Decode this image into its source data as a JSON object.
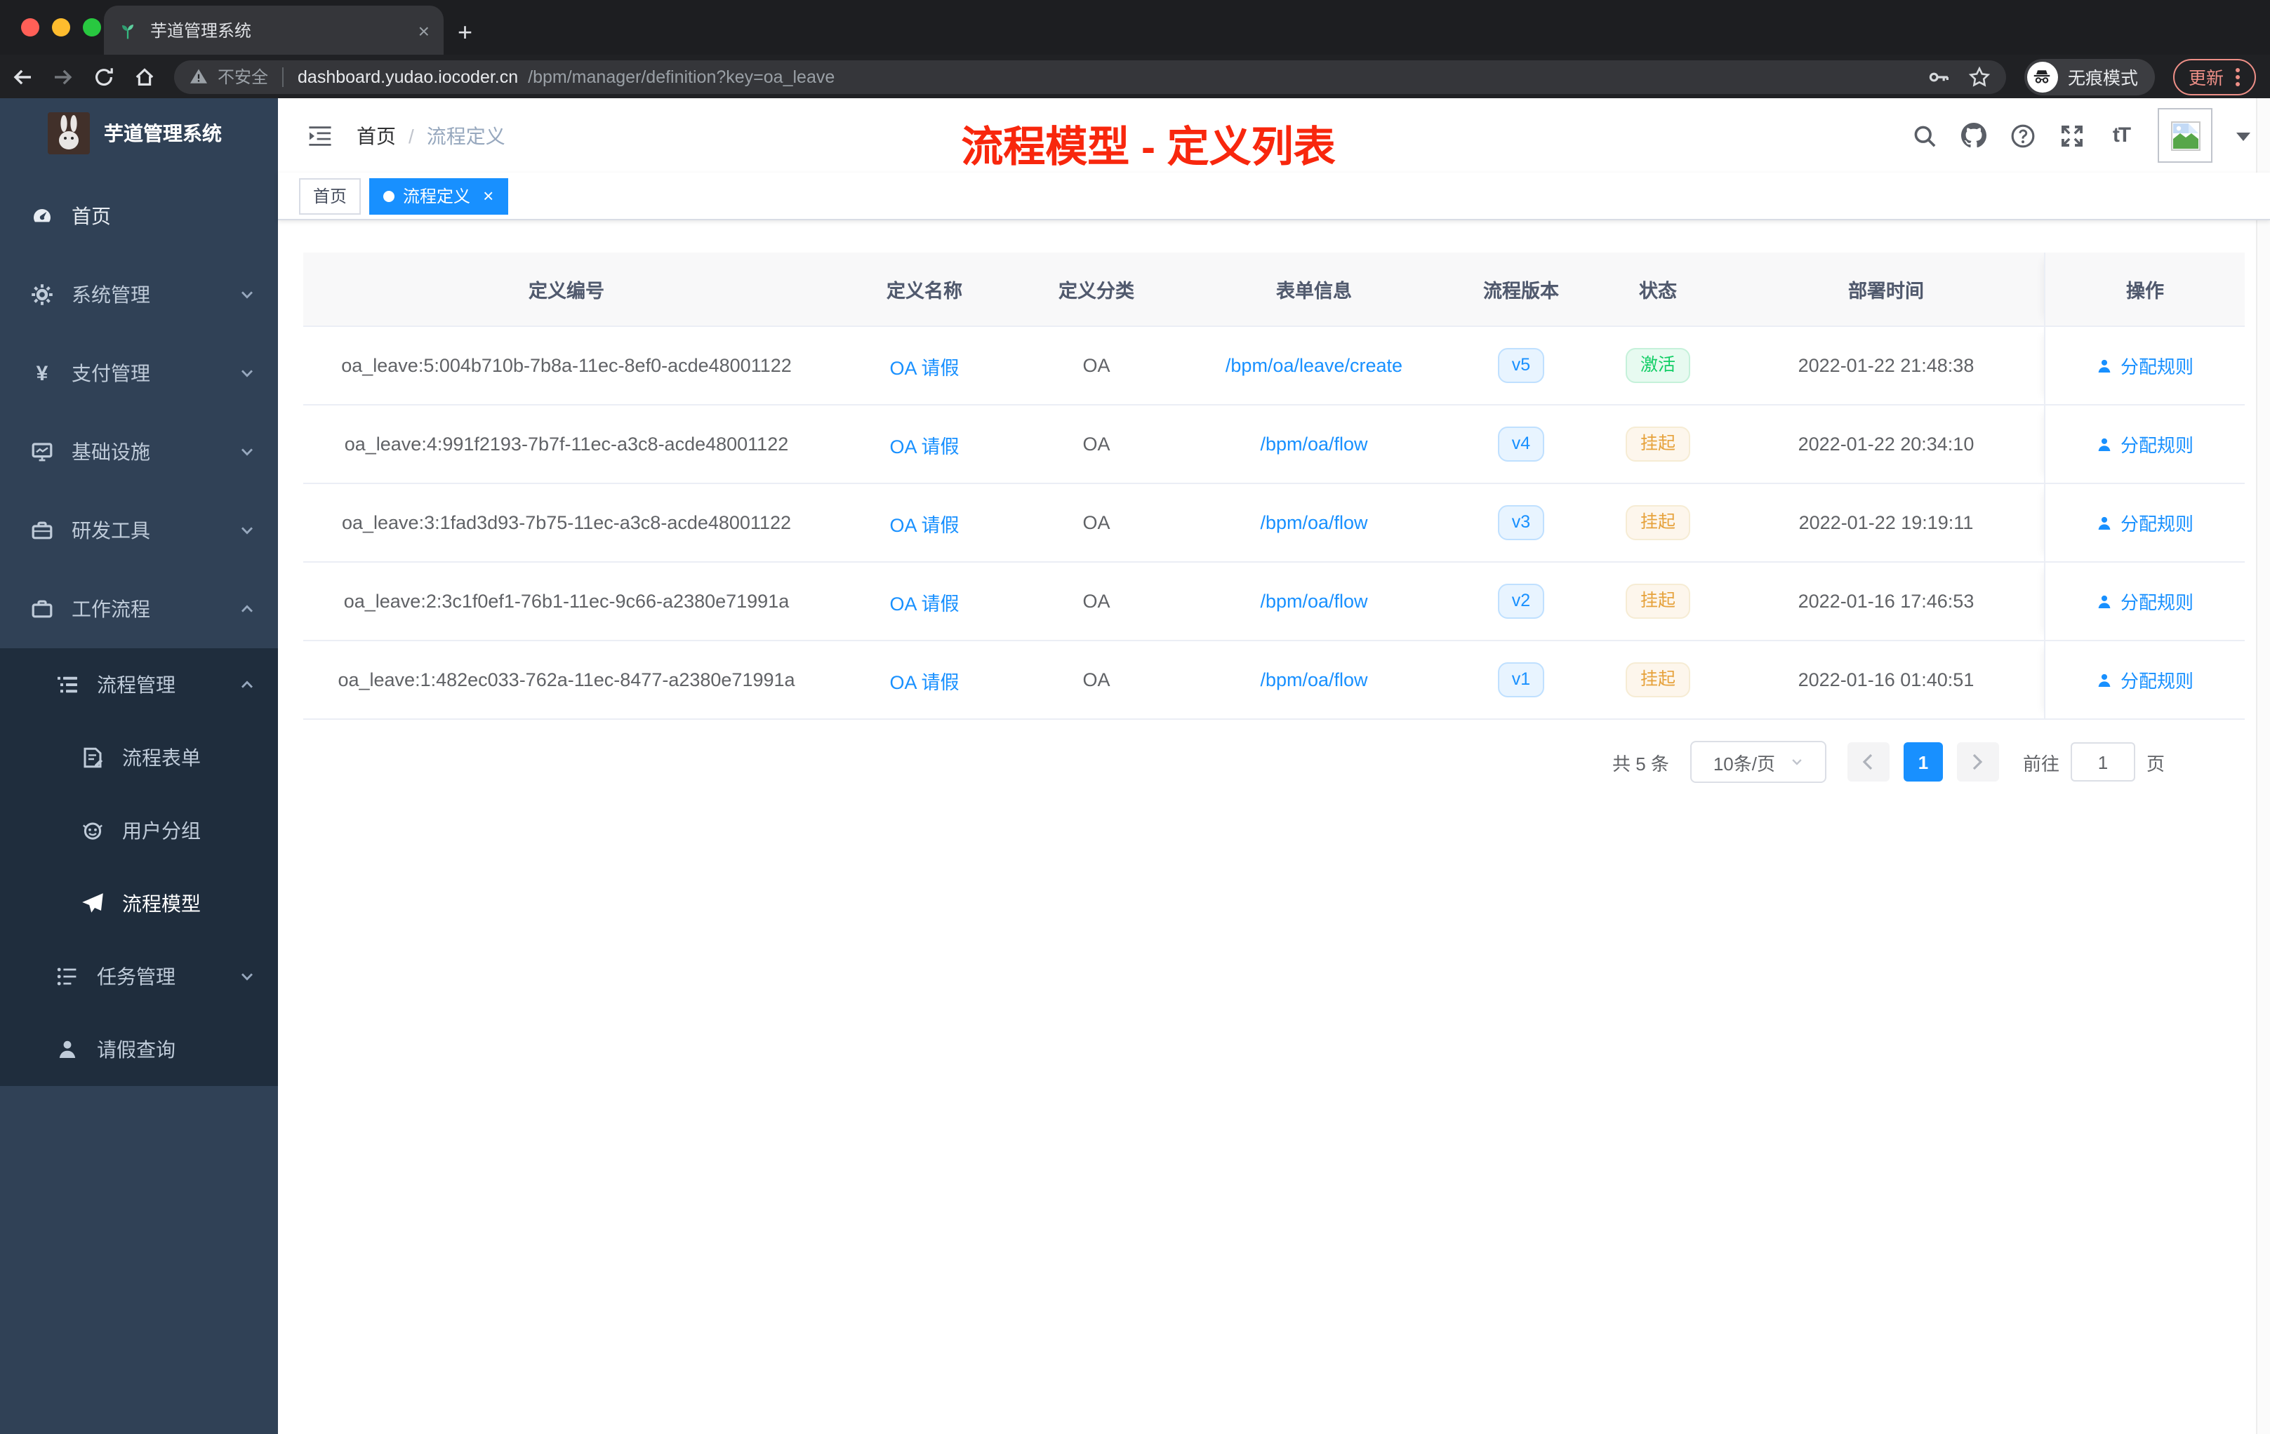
{
  "browser": {
    "tab_title": "芋道管理系统",
    "security_label": "不安全",
    "url_host": "dashboard.yudao.iocoder.cn",
    "url_path": "/bpm/manager/definition?key=oa_leave",
    "incognito_label": "无痕模式",
    "update_label": "更新"
  },
  "sidebar": {
    "app_title": "芋道管理系统",
    "items": [
      {
        "label": "首页",
        "icon": "dashboard-icon",
        "level": 0
      },
      {
        "label": "系统管理",
        "icon": "gear-icon",
        "level": 0,
        "chevron": "down"
      },
      {
        "label": "支付管理",
        "icon": "yen-icon",
        "level": 0,
        "chevron": "down"
      },
      {
        "label": "基础设施",
        "icon": "monitor-icon",
        "level": 0,
        "chevron": "down"
      },
      {
        "label": "研发工具",
        "icon": "toolbox-icon",
        "level": 0,
        "chevron": "down"
      },
      {
        "label": "工作流程",
        "icon": "briefcase-icon",
        "level": 0,
        "chevron": "up"
      },
      {
        "label": "流程管理",
        "icon": "tree-list-icon",
        "level": 1,
        "chevron": "up"
      },
      {
        "label": "流程表单",
        "icon": "form-icon",
        "level": 2
      },
      {
        "label": "用户分组",
        "icon": "robot-icon",
        "level": 2
      },
      {
        "label": "流程模型",
        "icon": "paper-plane-icon",
        "level": 2,
        "active": true
      },
      {
        "label": "任务管理",
        "icon": "flow-icon",
        "level": 1,
        "chevron": "down"
      },
      {
        "label": "请假查询",
        "icon": "person-icon",
        "level": 1
      }
    ]
  },
  "header": {
    "breadcrumb_home": "首页",
    "breadcrumb_separator": "/",
    "breadcrumb_current": "流程定义",
    "annotation": "流程模型 - 定义列表"
  },
  "tags": [
    {
      "label": "首页",
      "active": false
    },
    {
      "label": "流程定义",
      "active": true,
      "closable": true
    }
  ],
  "table": {
    "columns": [
      "定义编号",
      "定义名称",
      "定义分类",
      "表单信息",
      "流程版本",
      "状态",
      "部署时间",
      "操作"
    ],
    "rows": [
      {
        "id": "oa_leave:5:004b710b-7b8a-11ec-8ef0-acde48001122",
        "name": "OA 请假",
        "category": "OA",
        "form": "/bpm/oa/leave/create",
        "version": "v5",
        "status": "激活",
        "status_type": "active",
        "time": "2022-01-22 21:48:38",
        "action": "分配规则"
      },
      {
        "id": "oa_leave:4:991f2193-7b7f-11ec-a3c8-acde48001122",
        "name": "OA 请假",
        "category": "OA",
        "form": "/bpm/oa/flow",
        "version": "v4",
        "status": "挂起",
        "status_type": "suspended",
        "time": "2022-01-22 20:34:10",
        "action": "分配规则"
      },
      {
        "id": "oa_leave:3:1fad3d93-7b75-11ec-a3c8-acde48001122",
        "name": "OA 请假",
        "category": "OA",
        "form": "/bpm/oa/flow",
        "version": "v3",
        "status": "挂起",
        "status_type": "suspended",
        "time": "2022-01-22 19:19:11",
        "action": "分配规则"
      },
      {
        "id": "oa_leave:2:3c1f0ef1-76b1-11ec-9c66-a2380e71991a",
        "name": "OA 请假",
        "category": "OA",
        "form": "/bpm/oa/flow",
        "version": "v2",
        "status": "挂起",
        "status_type": "suspended",
        "time": "2022-01-16 17:46:53",
        "action": "分配规则"
      },
      {
        "id": "oa_leave:1:482ec033-762a-11ec-8477-a2380e71991a",
        "name": "OA 请假",
        "category": "OA",
        "form": "/bpm/oa/flow",
        "version": "v1",
        "status": "挂起",
        "status_type": "suspended",
        "time": "2022-01-16 01:40:51",
        "action": "分配规则"
      }
    ]
  },
  "pagination": {
    "total": "共 5 条",
    "page_size": "10条/页",
    "current_page": "1",
    "goto_label": "前往",
    "goto_value": "1",
    "page_unit": "页"
  },
  "colors": {
    "accent_blue": "#1890ff",
    "sidebar_bg": "#304156",
    "submenu_bg": "#1f2d3d",
    "status_active_green": "#13ce66",
    "status_suspended_orange": "#e6a23c",
    "annotation_red": "#f8270d"
  },
  "icons": {
    "yen_glyph": "¥",
    "font_size_glyph": "tT",
    "tab_close_glyph": "×",
    "tag_close_glyph": "×",
    "new_tab_glyph": "+"
  }
}
